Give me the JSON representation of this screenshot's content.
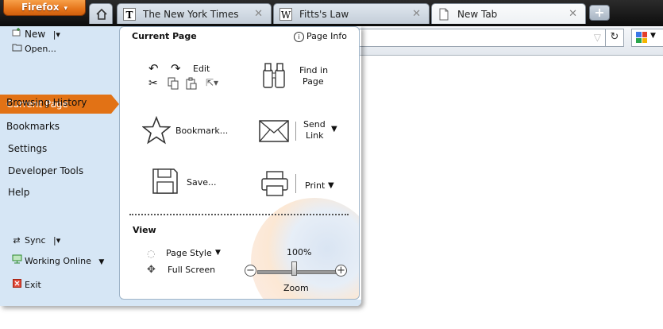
{
  "app": {
    "firefox_button": "Firefox",
    "tabs": [
      {
        "title": "The New York Times",
        "icon": "nyt-icon"
      },
      {
        "title": "Fitts's Law",
        "icon": "wikipedia-icon"
      },
      {
        "title": "New Tab",
        "icon": "page-icon"
      }
    ],
    "new_tab_label": "+"
  },
  "left_menu": {
    "new": "New",
    "open": "Open...",
    "items": [
      "Current Page",
      "Browsing History",
      "Bookmarks",
      "Settings",
      "Developer Tools",
      "Help"
    ],
    "sync": "Sync",
    "working_online": "Working Online",
    "exit": "Exit"
  },
  "current_page_panel": {
    "heading": "Current Page",
    "page_info": "Page Info",
    "edit": "Edit",
    "find_in_page_line1": "Find in",
    "find_in_page_line2": "Page",
    "bookmark": "Bookmark...",
    "send_link_line1": "Send",
    "send_link_line2": "Link",
    "save": "Save...",
    "print": "Print"
  },
  "view_panel": {
    "heading": "View",
    "page_style": "Page Style",
    "full_screen": "Full Screen",
    "zoom_value": "100%",
    "zoom_label": "Zoom"
  },
  "colors": {
    "accent": "#e27215",
    "menu_left_bg": "#d6e6f5"
  }
}
